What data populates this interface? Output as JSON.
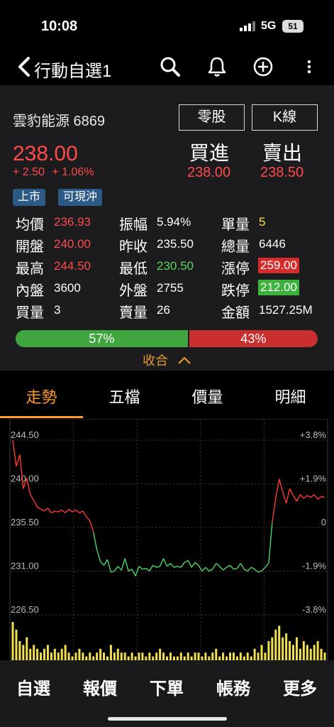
{
  "status": {
    "time": "10:08",
    "network": "5G",
    "battery": "51"
  },
  "header": {
    "title": "行動自選1",
    "icons": [
      "back-icon",
      "search-icon",
      "bell-icon",
      "add-icon",
      "more-icon"
    ]
  },
  "stock": {
    "name_code": "雲豹能源 6869",
    "price": "238.00",
    "change": "+ 2.50",
    "change_pct": "+ 1.06%",
    "odd_lot_label": "零股",
    "kline_label": "K線",
    "buy_label": "買進",
    "sell_label": "賣出",
    "buy_price": "238.00",
    "sell_price": "238.50",
    "tags": [
      "上市",
      "可現沖"
    ]
  },
  "stats": {
    "avg_label": "均價",
    "avg": "236.93",
    "amp_label": "振幅",
    "amp": "5.94%",
    "unit_label": "單量",
    "unit": "5",
    "open_label": "開盤",
    "open": "240.00",
    "prev_label": "昨收",
    "prev": "235.50",
    "total_label": "總量",
    "total": "6446",
    "high_label": "最高",
    "high": "244.50",
    "low_label": "最低",
    "low": "230.50",
    "limit_up_label": "漲停",
    "limit_up": "259.00",
    "inner_label": "內盤",
    "inner": "3600",
    "outer_label": "外盤",
    "outer": "2755",
    "limit_down_label": "跌停",
    "limit_down": "212.00",
    "bid_label": "買量",
    "bid": "3",
    "ask_label": "賣量",
    "ask": "26",
    "amount_label": "金額",
    "amount": "1527.25M"
  },
  "ratio": {
    "buy_pct": 57,
    "sell_pct": 43,
    "buy_text": "57%",
    "sell_text": "43%",
    "collapse_label": "收合"
  },
  "tabs": [
    {
      "label": "走勢",
      "active": true
    },
    {
      "label": "五檔",
      "active": false
    },
    {
      "label": "價量",
      "active": false
    },
    {
      "label": "明細",
      "active": false
    }
  ],
  "chart_data": {
    "type": "line",
    "y_tick_labels": [
      "244.50",
      "240.00",
      "235.50",
      "231.00",
      "226.50"
    ],
    "y_ticks": [
      244.5,
      240.0,
      235.5,
      231.0,
      226.5
    ],
    "right_tick_labels": [
      "+3.8%",
      "+1.9%",
      "0",
      "-1.9%",
      "-3.8%"
    ],
    "reference_price": 235.5,
    "ylim": [
      226.5,
      244.5
    ],
    "colors": {
      "up": "#ff3b30",
      "down": "#4cd964",
      "volume": "#f2e14c",
      "grid": "#3a3a3a"
    },
    "price_series": [
      244.5,
      241.8,
      243.0,
      239.5,
      240.6,
      238.9,
      238.3,
      237.6,
      237.4,
      237.2,
      237.5,
      237.0,
      237.2,
      237.1,
      237.3,
      237.0,
      237.4,
      237.1,
      237.3,
      237.0,
      237.2,
      236.6,
      236.2,
      235.0,
      233.2,
      232.0,
      231.6,
      232.2,
      230.9,
      231.0,
      231.5,
      231.1,
      232.3,
      231.0,
      231.2,
      230.5,
      231.5,
      231.2,
      231.3,
      231.0,
      231.6,
      231.4,
      231.5,
      232.3,
      231.5,
      231.8,
      231.4,
      231.5,
      231.4,
      231.9,
      232.1,
      231.4,
      231.9,
      231.6,
      231.0,
      231.4,
      231.0,
      231.2,
      231.8,
      231.5,
      231.1,
      231.4,
      231.6,
      231.2,
      231.3,
      231.8,
      231.2,
      231.0,
      231.4,
      231.2,
      230.9,
      231.0,
      231.4,
      231.8,
      236.0,
      238.5,
      240.5,
      239.2,
      238.0,
      239.5,
      238.8,
      238.2,
      238.9,
      238.5,
      238.8,
      238.6,
      238.9,
      238.4,
      238.7,
      238.6
    ],
    "volume_series": [
      10,
      8,
      5,
      4,
      6,
      3,
      4,
      3,
      2,
      3,
      4,
      2,
      3,
      2,
      3,
      4,
      2,
      1,
      2,
      3,
      2,
      1,
      2,
      1,
      2,
      3,
      2,
      1,
      4,
      2,
      3,
      2,
      2,
      1,
      2,
      1,
      2,
      2,
      1,
      2,
      1,
      2,
      3,
      2,
      1,
      2,
      1,
      1,
      2,
      1,
      2,
      1,
      2,
      2,
      1,
      2,
      1,
      2,
      3,
      1,
      2,
      1,
      2,
      2,
      1,
      2,
      1,
      2,
      1,
      3,
      2,
      4,
      2,
      5,
      6,
      8,
      9,
      6,
      7,
      5,
      4,
      6,
      3,
      5,
      4,
      3,
      4,
      5,
      3,
      2
    ]
  },
  "bottom_nav": [
    "自選",
    "報價",
    "下單",
    "帳務",
    "更多"
  ]
}
